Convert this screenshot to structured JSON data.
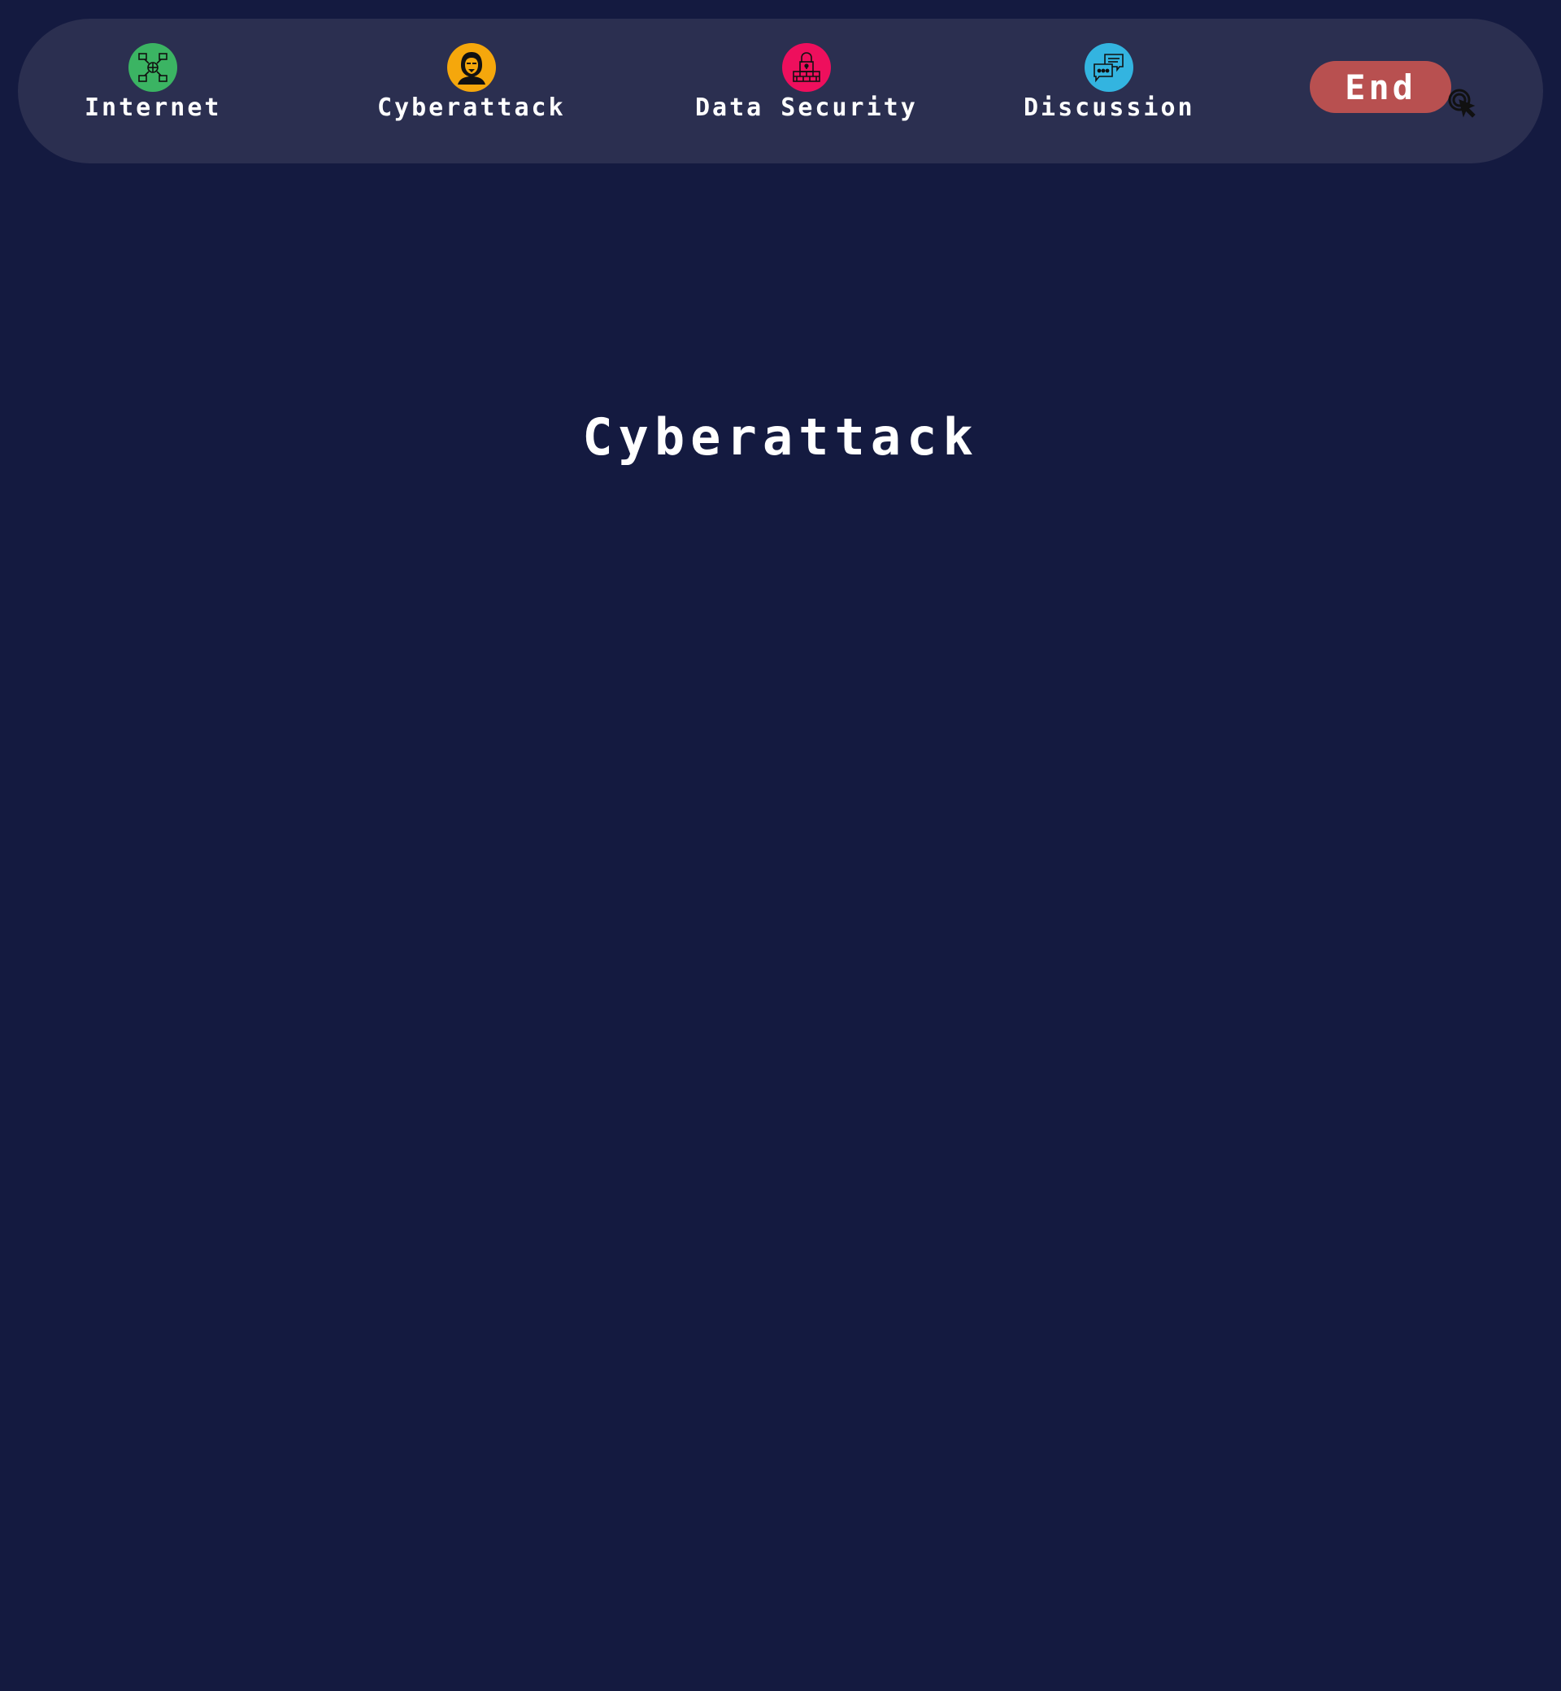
{
  "nav": {
    "items": [
      {
        "label": "Internet",
        "icon": "network-globe-icon",
        "color": "#3bb463"
      },
      {
        "label": "Cyberattack",
        "icon": "hacker-icon",
        "color": "#f5a70c"
      },
      {
        "label": "Data Security",
        "icon": "firewall-lock-icon",
        "color": "#ee0f5d"
      },
      {
        "label": "Discussion",
        "icon": "chat-bubbles-icon",
        "color": "#33b4e0"
      }
    ],
    "end_label": "End",
    "end_color": "#b85050"
  },
  "main": {
    "title": "Cyberattack"
  },
  "colors": {
    "background": "#141a40",
    "navbar": "#2b2f50",
    "text": "#ffffff"
  }
}
